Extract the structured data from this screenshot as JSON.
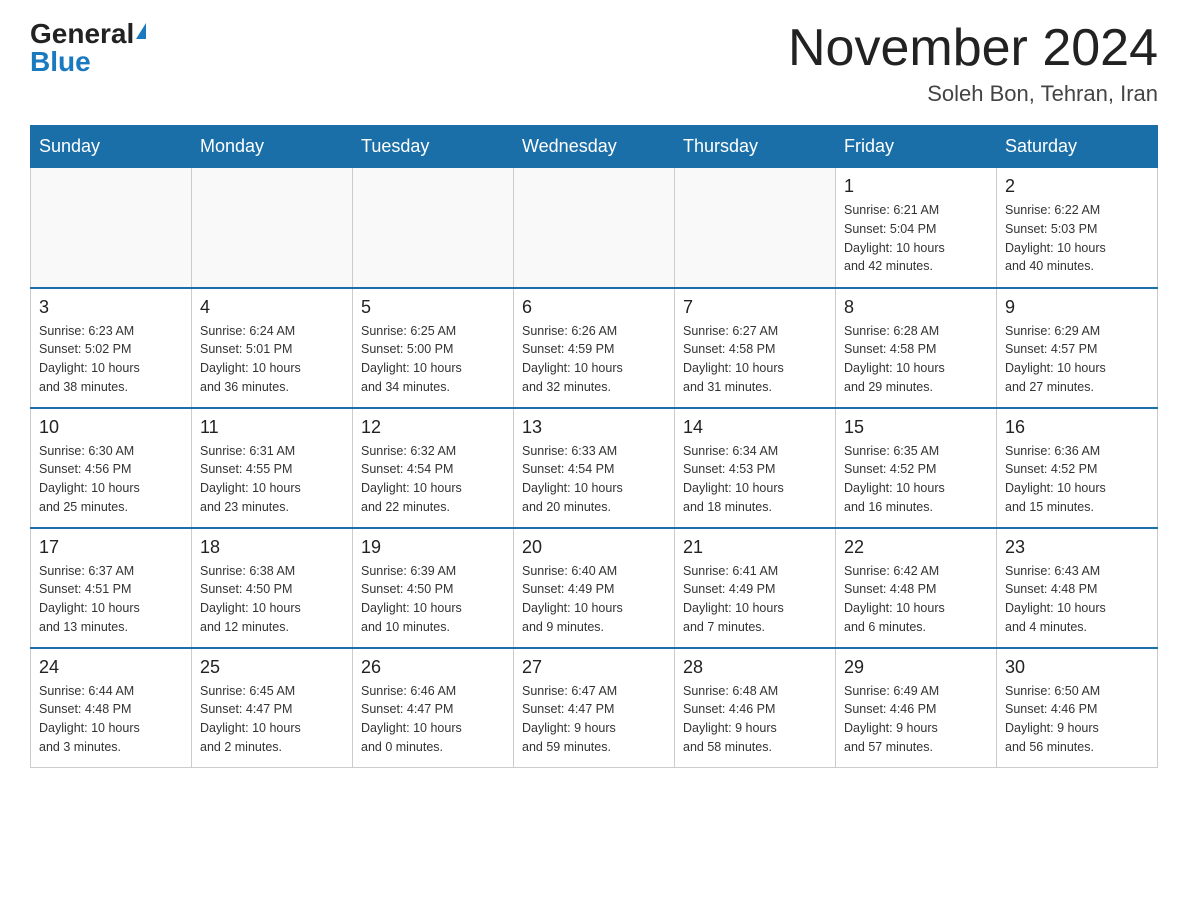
{
  "header": {
    "logo_general": "General",
    "logo_blue": "Blue",
    "month_title": "November 2024",
    "location": "Soleh Bon, Tehran, Iran"
  },
  "weekdays": [
    "Sunday",
    "Monday",
    "Tuesday",
    "Wednesday",
    "Thursday",
    "Friday",
    "Saturday"
  ],
  "weeks": [
    [
      {
        "day": "",
        "info": ""
      },
      {
        "day": "",
        "info": ""
      },
      {
        "day": "",
        "info": ""
      },
      {
        "day": "",
        "info": ""
      },
      {
        "day": "",
        "info": ""
      },
      {
        "day": "1",
        "info": "Sunrise: 6:21 AM\nSunset: 5:04 PM\nDaylight: 10 hours\nand 42 minutes."
      },
      {
        "day": "2",
        "info": "Sunrise: 6:22 AM\nSunset: 5:03 PM\nDaylight: 10 hours\nand 40 minutes."
      }
    ],
    [
      {
        "day": "3",
        "info": "Sunrise: 6:23 AM\nSunset: 5:02 PM\nDaylight: 10 hours\nand 38 minutes."
      },
      {
        "day": "4",
        "info": "Sunrise: 6:24 AM\nSunset: 5:01 PM\nDaylight: 10 hours\nand 36 minutes."
      },
      {
        "day": "5",
        "info": "Sunrise: 6:25 AM\nSunset: 5:00 PM\nDaylight: 10 hours\nand 34 minutes."
      },
      {
        "day": "6",
        "info": "Sunrise: 6:26 AM\nSunset: 4:59 PM\nDaylight: 10 hours\nand 32 minutes."
      },
      {
        "day": "7",
        "info": "Sunrise: 6:27 AM\nSunset: 4:58 PM\nDaylight: 10 hours\nand 31 minutes."
      },
      {
        "day": "8",
        "info": "Sunrise: 6:28 AM\nSunset: 4:58 PM\nDaylight: 10 hours\nand 29 minutes."
      },
      {
        "day": "9",
        "info": "Sunrise: 6:29 AM\nSunset: 4:57 PM\nDaylight: 10 hours\nand 27 minutes."
      }
    ],
    [
      {
        "day": "10",
        "info": "Sunrise: 6:30 AM\nSunset: 4:56 PM\nDaylight: 10 hours\nand 25 minutes."
      },
      {
        "day": "11",
        "info": "Sunrise: 6:31 AM\nSunset: 4:55 PM\nDaylight: 10 hours\nand 23 minutes."
      },
      {
        "day": "12",
        "info": "Sunrise: 6:32 AM\nSunset: 4:54 PM\nDaylight: 10 hours\nand 22 minutes."
      },
      {
        "day": "13",
        "info": "Sunrise: 6:33 AM\nSunset: 4:54 PM\nDaylight: 10 hours\nand 20 minutes."
      },
      {
        "day": "14",
        "info": "Sunrise: 6:34 AM\nSunset: 4:53 PM\nDaylight: 10 hours\nand 18 minutes."
      },
      {
        "day": "15",
        "info": "Sunrise: 6:35 AM\nSunset: 4:52 PM\nDaylight: 10 hours\nand 16 minutes."
      },
      {
        "day": "16",
        "info": "Sunrise: 6:36 AM\nSunset: 4:52 PM\nDaylight: 10 hours\nand 15 minutes."
      }
    ],
    [
      {
        "day": "17",
        "info": "Sunrise: 6:37 AM\nSunset: 4:51 PM\nDaylight: 10 hours\nand 13 minutes."
      },
      {
        "day": "18",
        "info": "Sunrise: 6:38 AM\nSunset: 4:50 PM\nDaylight: 10 hours\nand 12 minutes."
      },
      {
        "day": "19",
        "info": "Sunrise: 6:39 AM\nSunset: 4:50 PM\nDaylight: 10 hours\nand 10 minutes."
      },
      {
        "day": "20",
        "info": "Sunrise: 6:40 AM\nSunset: 4:49 PM\nDaylight: 10 hours\nand 9 minutes."
      },
      {
        "day": "21",
        "info": "Sunrise: 6:41 AM\nSunset: 4:49 PM\nDaylight: 10 hours\nand 7 minutes."
      },
      {
        "day": "22",
        "info": "Sunrise: 6:42 AM\nSunset: 4:48 PM\nDaylight: 10 hours\nand 6 minutes."
      },
      {
        "day": "23",
        "info": "Sunrise: 6:43 AM\nSunset: 4:48 PM\nDaylight: 10 hours\nand 4 minutes."
      }
    ],
    [
      {
        "day": "24",
        "info": "Sunrise: 6:44 AM\nSunset: 4:48 PM\nDaylight: 10 hours\nand 3 minutes."
      },
      {
        "day": "25",
        "info": "Sunrise: 6:45 AM\nSunset: 4:47 PM\nDaylight: 10 hours\nand 2 minutes."
      },
      {
        "day": "26",
        "info": "Sunrise: 6:46 AM\nSunset: 4:47 PM\nDaylight: 10 hours\nand 0 minutes."
      },
      {
        "day": "27",
        "info": "Sunrise: 6:47 AM\nSunset: 4:47 PM\nDaylight: 9 hours\nand 59 minutes."
      },
      {
        "day": "28",
        "info": "Sunrise: 6:48 AM\nSunset: 4:46 PM\nDaylight: 9 hours\nand 58 minutes."
      },
      {
        "day": "29",
        "info": "Sunrise: 6:49 AM\nSunset: 4:46 PM\nDaylight: 9 hours\nand 57 minutes."
      },
      {
        "day": "30",
        "info": "Sunrise: 6:50 AM\nSunset: 4:46 PM\nDaylight: 9 hours\nand 56 minutes."
      }
    ]
  ]
}
